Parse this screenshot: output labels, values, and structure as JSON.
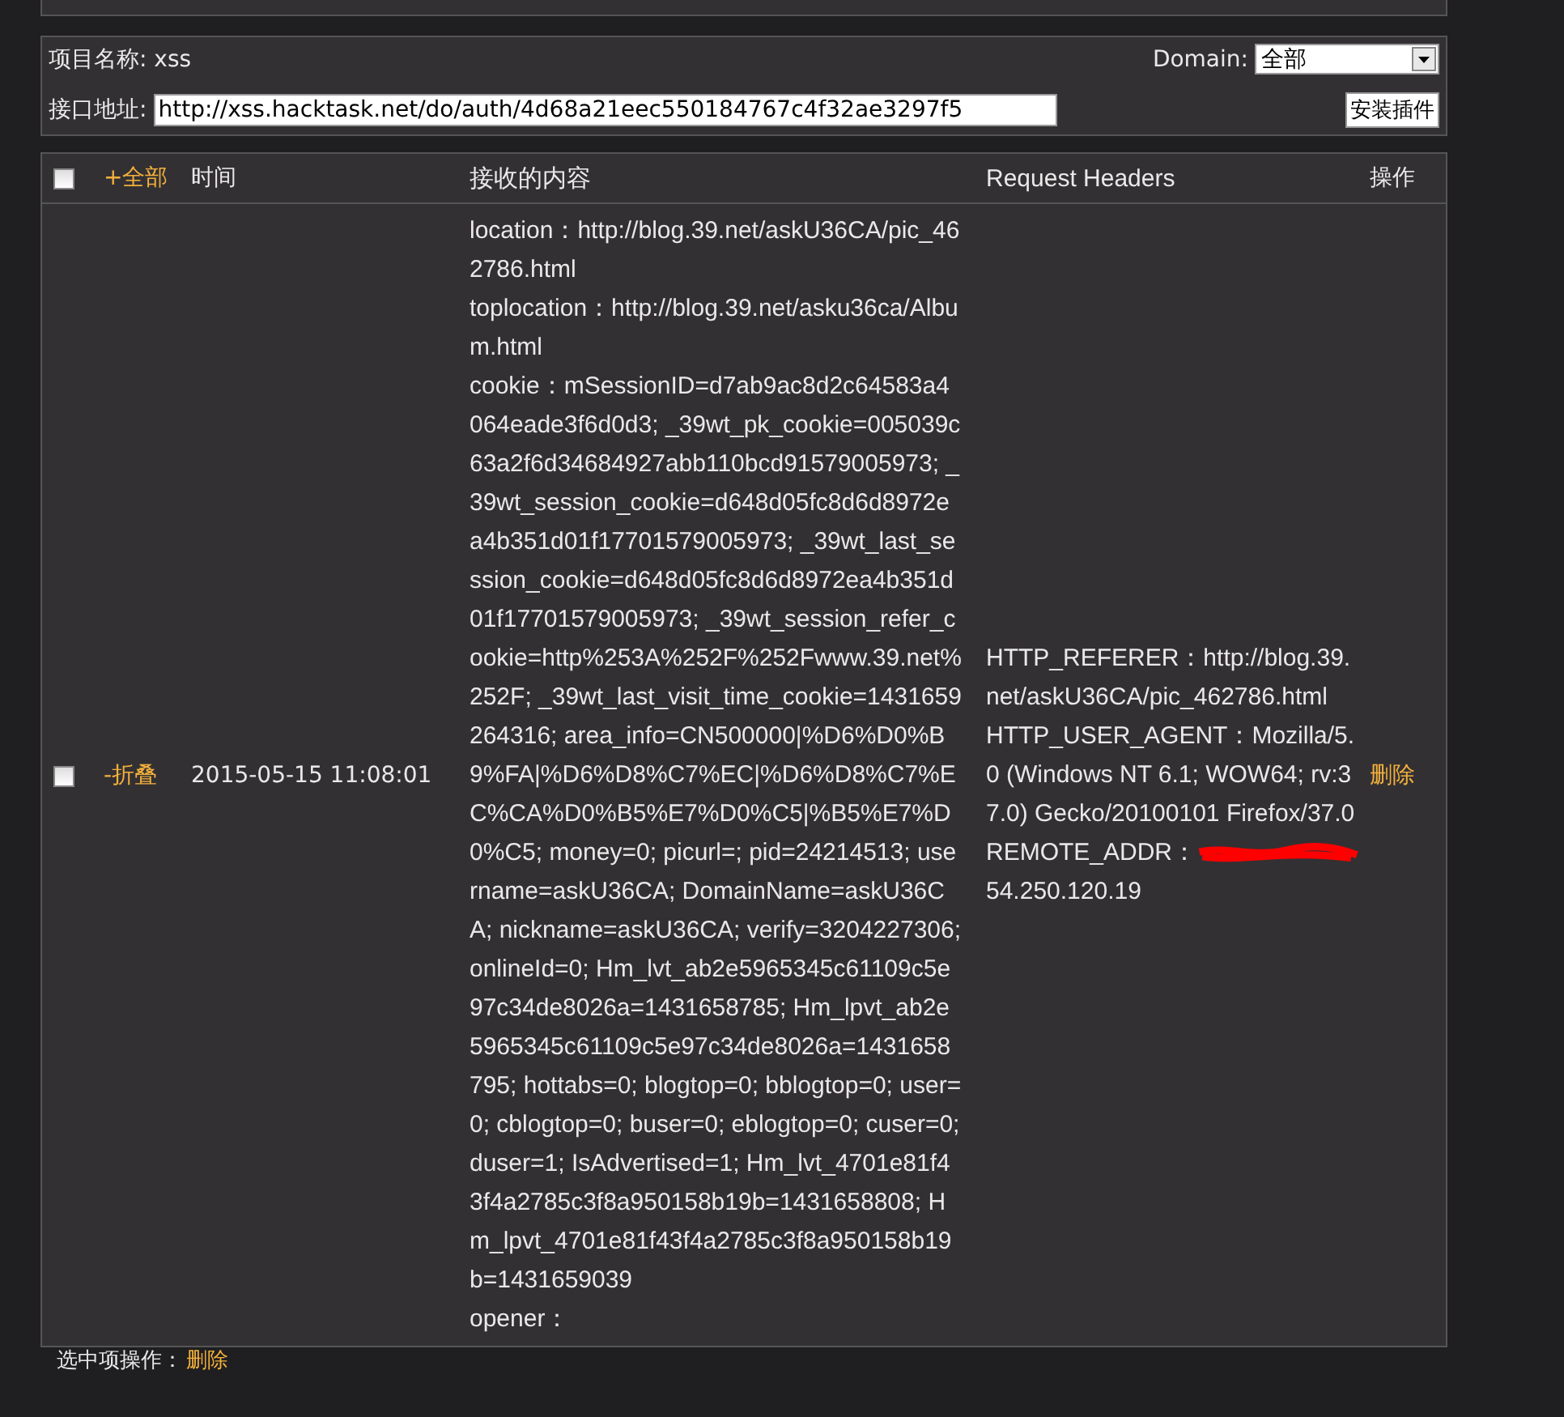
{
  "project": {
    "label": "项目名称:",
    "value": "xss"
  },
  "domain": {
    "label": "Domain:",
    "value": "全部"
  },
  "endpoint": {
    "label": "接口地址:",
    "value": "http://xss.hacktask.net/do/auth/4d68a21eec550184767c4f32ae3297f5"
  },
  "install_button": "安装插件",
  "table": {
    "select_all": {
      "checked": false
    },
    "columns": [
      {
        "kind": "toggle",
        "label": "+全部"
      },
      {
        "kind": "text",
        "label": "时间"
      },
      {
        "kind": "text",
        "label": "接收的内容"
      },
      {
        "kind": "text",
        "label": "Request Headers"
      },
      {
        "kind": "text",
        "label": "操作"
      }
    ],
    "rows": [
      {
        "checked": false,
        "toggle": "-折叠",
        "time": "2015-05-15 11:08:01",
        "content": [
          "location：http://blog.39.net/askU36CA/pic_462786.html",
          "toplocation：http://blog.39.net/asku36ca/Album.html",
          "cookie：mSessionID=d7ab9ac8d2c64583a4064eade3f6d0d3; _39wt_pk_cookie=005039c63a2f6d34684927abb110bcd91579005973; _39wt_session_cookie=d648d05fc8d6d8972ea4b351d01f17701579005973; _39wt_last_session_cookie=d648d05fc8d6d8972ea4b351d01f17701579005973; _39wt_session_refer_cookie=http%253A%252F%252Fwww.39.net%252F; _39wt_last_visit_time_cookie=1431659264316; area_info=CN500000|%D6%D0%B9%FA|%D6%D8%C7%EC|%D6%D8%C7%EC%CA%D0%B5%E7%D0%C5|%B5%E7%D0%C5; money=0; picurl=; pid=24214513; username=askU36CA; DomainName=askU36CA; nickname=askU36CA; verify=3204227306; onlineId=0; Hm_lvt_ab2e5965345c61109c5e97c34de8026a=1431658785; Hm_lpvt_ab2e5965345c61109c5e97c34de8026a=1431658795; hottabs=0; blogtop=0; bblogtop=0; user=0; cblogtop=0; buser=0; eblogtop=0; cuser=0; duser=1; IsAdvertised=1; Hm_lvt_4701e81f43f4a2785c3f8a950158b19b=1431658808; Hm_lpvt_4701e81f43f4a2785c3f8a950158b19b=1431659039",
          "opener："
        ],
        "headers": [
          {
            "text": "HTTP_REFERER：http://blog.39.net/askU36CA/pic_462786.html",
            "redacted": false
          },
          {
            "text": "HTTP_USER_AGENT：Mozilla/5.0 (Windows NT 6.1; WOW64; rv:37.0) Gecko/20100101 Firefox/37.0",
            "redacted": false
          },
          {
            "text": "REMOTE_ADDR：",
            "redacted": true
          },
          {
            "text": "54.250.120.19",
            "redacted": false
          }
        ],
        "action": "删除"
      }
    ]
  },
  "footer": {
    "label": "选中项操作：",
    "action": "删除"
  }
}
